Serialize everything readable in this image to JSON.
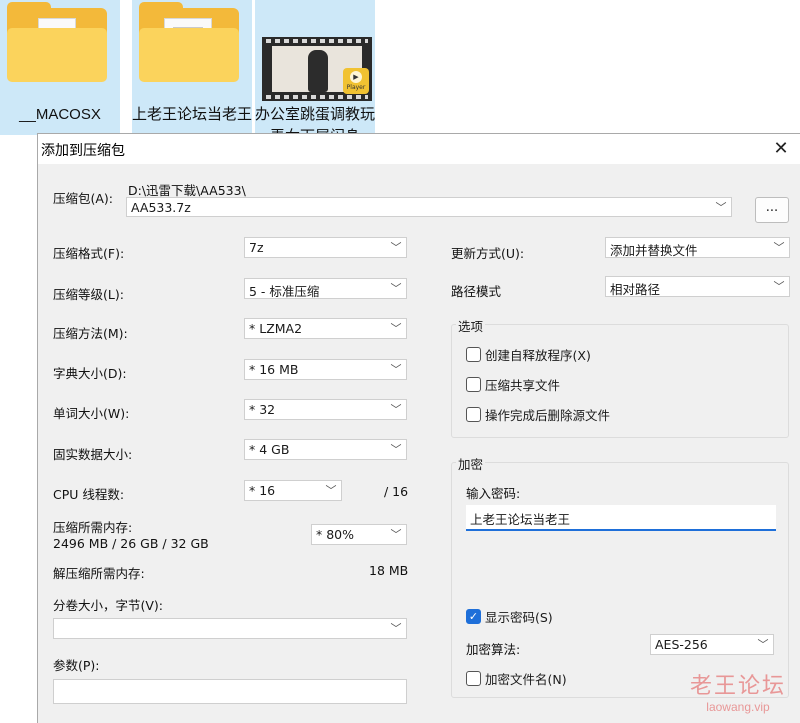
{
  "explorer": {
    "files": [
      {
        "name": "__MACOSX",
        "type": "folder"
      },
      {
        "name": "上老王论坛当老王",
        "type": "folder"
      },
      {
        "name": "办公室跳蛋调教玩弄女下属闷身",
        "type": "video"
      }
    ],
    "badge_text": "Player"
  },
  "dialog": {
    "title": "添加到压缩包",
    "close_glyph": "✕",
    "archive_label": "压缩包(A):",
    "archive_path": "D:\\迅雷下载\\AA533\\",
    "archive_name": "AA533.7z",
    "browse_label": "...",
    "left": {
      "format_label": "压缩格式(F):",
      "format_value": "7z",
      "level_label": "压缩等级(L):",
      "level_value": "5 - 标准压缩",
      "method_label": "压缩方法(M):",
      "method_value": "*  LZMA2",
      "dict_label": "字典大小(D):",
      "dict_value": "*  16 MB",
      "word_label": "单词大小(W):",
      "word_value": "*  32",
      "solid_label": "固实数据大小:",
      "solid_value": "*  4 GB",
      "threads_label": "CPU 线程数:",
      "threads_value": "*  16",
      "threads_total": "/ 16",
      "mem_label": "压缩所需内存:",
      "mem_value": "2496 MB / 26 GB / 32 GB",
      "mem_percent": "*  80%",
      "decomp_label": "解压缩所需内存:",
      "decomp_value": "18 MB",
      "split_label": "分卷大小，字节(V):",
      "split_value": "",
      "params_label": "参数(P):",
      "params_value": ""
    },
    "right": {
      "update_label": "更新方式(U):",
      "update_value": "添加并替换文件",
      "path_label": "路径模式",
      "path_value": "相对路径",
      "options_title": "选项",
      "opt_sfx": "创建自释放程序(X)",
      "opt_shared": "压缩共享文件",
      "opt_delete": "操作完成后删除源文件",
      "encrypt_title": "加密",
      "pwd_label": "输入密码:",
      "pwd_value": "上老王论坛当老王",
      "show_pwd": "显示密码(S)",
      "algo_label": "加密算法:",
      "algo_value": "AES-256",
      "encrypt_names": "加密文件名(N)"
    }
  },
  "watermark": {
    "line1": "老王论坛",
    "line2": "laowang.vip"
  },
  "colors": {
    "accent": "#1e6fd9",
    "tile_selected": "#cde8f8",
    "folder": "#f3b93a"
  }
}
